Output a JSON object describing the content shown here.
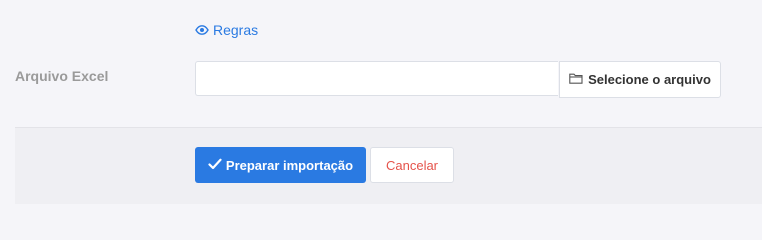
{
  "rules_link": {
    "label": "Regras",
    "icon": "eye-icon"
  },
  "file_field": {
    "label": "Arquivo Excel",
    "value": "",
    "button_label": "Selecione o arquivo",
    "button_icon": "folder-icon"
  },
  "actions": {
    "prepare_label": "Preparar importação",
    "prepare_icon": "check-icon",
    "cancel_label": "Cancelar"
  },
  "colors": {
    "primary": "#2a7ae2",
    "danger": "#e5534b",
    "label_gray": "#9a9a9a",
    "background": "#f5f5f9"
  }
}
